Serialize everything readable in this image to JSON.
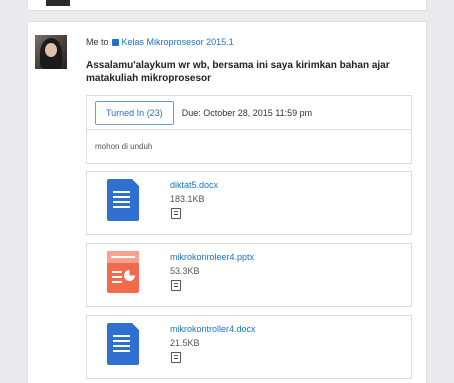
{
  "post": {
    "author": "Me",
    "to_word": "to",
    "class_name": "Kelas Mikroprosesor 2015.1",
    "message": "Assalamu'alaykum wr wb, bersama ini saya kirimkan bahan ajar matakuliah mikroprosesor"
  },
  "assignment": {
    "turned_in_label": "Turned In (23)",
    "due_label": "Due: October 28, 2015 11:59 pm",
    "description": "mohon di unduh"
  },
  "files": [
    {
      "name": "diktat5.docx",
      "size": "183.1KB",
      "icon": "word-document-icon"
    },
    {
      "name": "mikrokonroleer4.pptx",
      "size": "53.3KB",
      "icon": "powerpoint-icon"
    },
    {
      "name": "mikrokontroller4.docx",
      "size": "21.5KB",
      "icon": "word-document-icon"
    }
  ],
  "colors": {
    "link_blue": "#1a73c8",
    "doc_blue": "#2e6fd0",
    "ppt_orange": "#f26a4b"
  }
}
